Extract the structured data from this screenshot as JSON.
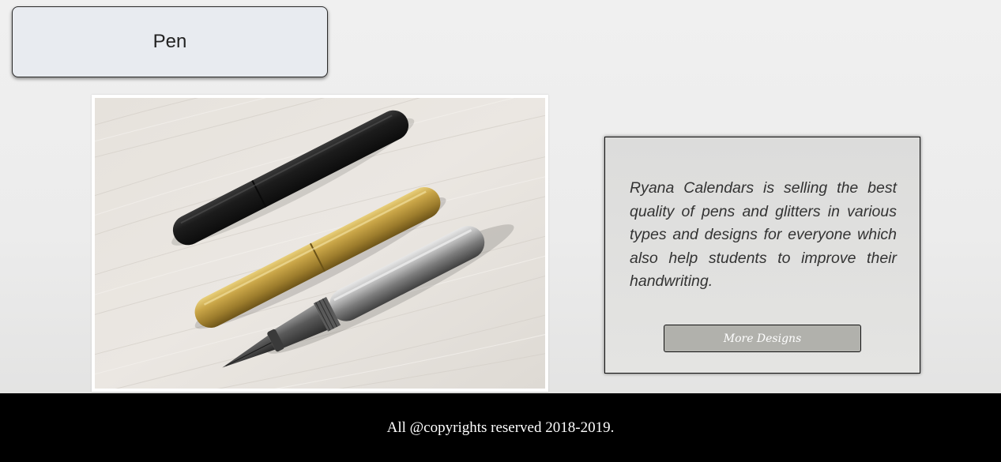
{
  "header": {
    "title": "Pen"
  },
  "product_image": {
    "subject": "three-bullet-fountain-pens-black-brass-steel"
  },
  "info_card": {
    "description": "Ryana Calendars is selling the best quality of pens and glitters in various types and designs for everyone which also help students to improve their handwriting.",
    "button_label": "More Designs"
  },
  "footer": {
    "text": "All @copyrights reserved 2018-2019."
  },
  "colors": {
    "title_box_bg": "#e8ebf0",
    "card_bg": "#e0e0de",
    "button_bg": "#b1b1ac",
    "footer_bg": "#000000",
    "footer_text": "#ffffff"
  }
}
